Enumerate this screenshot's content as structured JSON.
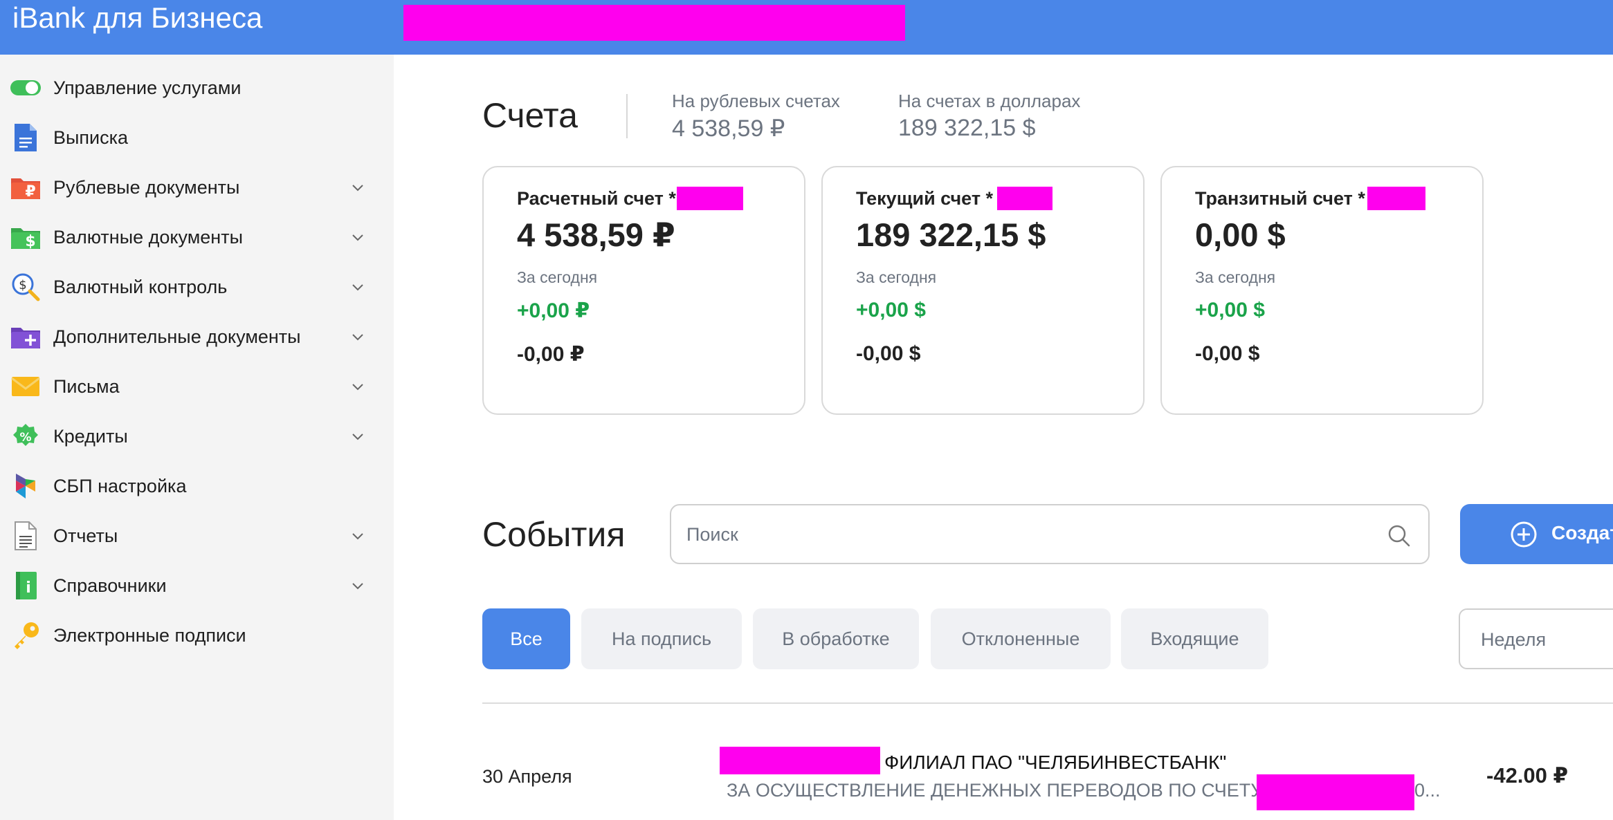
{
  "header": {
    "brand": "iBank для Бизнеса",
    "color": "#4a86e8"
  },
  "sidebar": {
    "items": [
      {
        "label": "Управление услугами",
        "icon": "toggle-icon",
        "has_chevron": false
      },
      {
        "label": "Выписка",
        "icon": "document-icon",
        "has_chevron": false
      },
      {
        "label": "Рублевые документы",
        "icon": "ruble-folder-icon",
        "has_chevron": true
      },
      {
        "label": "Валютные документы",
        "icon": "dollar-folder-icon",
        "has_chevron": true
      },
      {
        "label": "Валютный контроль",
        "icon": "currency-search-icon",
        "has_chevron": true
      },
      {
        "label": "Дополнительные документы",
        "icon": "add-folder-icon",
        "has_chevron": true
      },
      {
        "label": "Письма",
        "icon": "envelope-icon",
        "has_chevron": true
      },
      {
        "label": "Кредиты",
        "icon": "percent-badge-icon",
        "has_chevron": true
      },
      {
        "label": "СБП настройка",
        "icon": "sbp-logo-icon",
        "has_chevron": false
      },
      {
        "label": "Отчеты",
        "icon": "report-icon",
        "has_chevron": true
      },
      {
        "label": "Справочники",
        "icon": "info-book-icon",
        "has_chevron": true
      },
      {
        "label": "Электронные подписи",
        "icon": "key-icon",
        "has_chevron": false
      }
    ]
  },
  "accounts": {
    "heading": "Счета",
    "rub_label": "На рублевых счетах",
    "rub_value": "4 538,59 ₽",
    "usd_label": "На счетах в долларах",
    "usd_value": "189 322,15 $",
    "cards": [
      {
        "title": "Расчетный счет *",
        "balance": "4 538,59 ₽",
        "today_label": "За сегодня",
        "plus": "+0,00 ₽",
        "minus": "-0,00 ₽"
      },
      {
        "title": "Текущий счет *",
        "balance": "189 322,15 $",
        "today_label": "За сегодня",
        "plus": "+0,00 $",
        "minus": "-0,00 $"
      },
      {
        "title": "Транзитный счет *",
        "balance": "0,00 $",
        "today_label": "За сегодня",
        "plus": "+0,00 $",
        "minus": "-0,00 $"
      }
    ]
  },
  "events": {
    "heading": "События",
    "search_placeholder": "Поиск",
    "create_label": "Создат",
    "filters": [
      "Все",
      "На подпись",
      "В обработке",
      "Отклоненные",
      "Входящие"
    ],
    "active_filter": "Все",
    "period": "Неделя",
    "items": [
      {
        "date": "30 Апреля",
        "title": "ФИЛИАЛ ПАО \"ЧЕЛЯБИНВЕСТБАНК\"",
        "subtitle": "ЗА ОСУЩЕСТВЛЕНИЕ ДЕНЕЖНЫХ ПЕРЕВОДОВ ПО СЧЕТУ",
        "subtitle_tail": "0...",
        "amount": "-42.00 ₽"
      }
    ]
  },
  "colors": {
    "accent": "#4a86e8",
    "positive": "#1aa34a",
    "redaction": "#ff00ee"
  }
}
